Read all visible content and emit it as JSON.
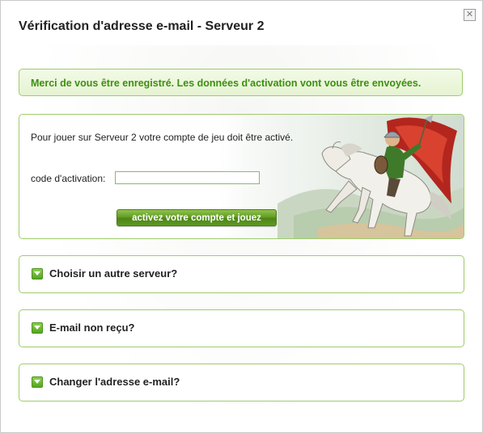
{
  "dialog": {
    "title": "Vérification d'adresse e-mail - Serveur 2",
    "close_symbol": "✕",
    "notice": "Merci de vous être enregistré. Les données d'activation vont vous être envoyées."
  },
  "activation": {
    "intro": "Pour jouer sur Serveur 2 votre compte de jeu doit être activé.",
    "code_label": "code d'activation:",
    "code_value": "",
    "button_label": "activez votre compte et jouez",
    "illustration": "mounted-knight-on-white-horse"
  },
  "accordion": [
    {
      "label": "Choisir un autre serveur?",
      "icon": "chevron-down-icon"
    },
    {
      "label": "E-mail non reçu?",
      "icon": "chevron-down-icon"
    },
    {
      "label": "Changer l'adresse e-mail?",
      "icon": "chevron-down-icon"
    }
  ],
  "colors": {
    "accent_green": "#3c8f12",
    "border_green": "#9fcb6b",
    "button_green": "#5f9a22"
  }
}
